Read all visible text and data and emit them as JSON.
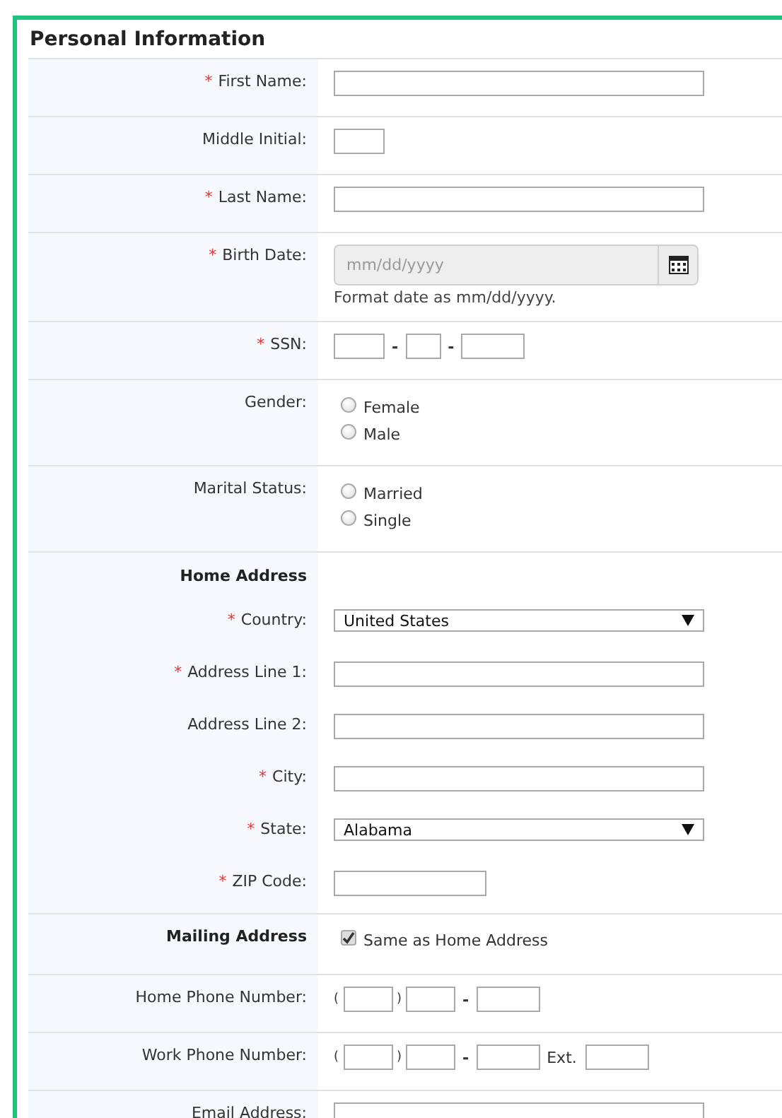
{
  "title": "Personal Information",
  "required_mark": "*",
  "rows": [
    {
      "kind": "text",
      "label": "First Name:",
      "required": true
    },
    {
      "kind": "initial",
      "label": "Middle Initial:",
      "required": false
    },
    {
      "kind": "text",
      "label": "Last Name:",
      "required": true
    },
    {
      "kind": "date",
      "label": "Birth Date:",
      "required": true,
      "placeholder": "mm/dd/yyyy",
      "hint": "Format date as mm/dd/yyyy."
    },
    {
      "kind": "ssn",
      "label": "SSN:",
      "required": true,
      "separator": "-"
    },
    {
      "kind": "radio",
      "label": "Gender:",
      "required": false,
      "options": [
        {
          "label": "Female",
          "selected": false
        },
        {
          "label": "Male",
          "selected": false
        }
      ]
    },
    {
      "kind": "radio",
      "label": "Marital Status:",
      "required": false,
      "options": [
        {
          "label": "Married",
          "selected": false
        },
        {
          "label": "Single",
          "selected": false
        }
      ]
    },
    {
      "kind": "group",
      "title": "Home Address",
      "fields": [
        {
          "kind": "select",
          "label": "Country:",
          "required": true,
          "value": "United States"
        },
        {
          "kind": "text",
          "label": "Address Line 1:",
          "required": true
        },
        {
          "kind": "text",
          "label": "Address Line 2:",
          "required": false
        },
        {
          "kind": "text",
          "label": "City:",
          "required": true
        },
        {
          "kind": "select",
          "label": "State:",
          "required": true,
          "value": "Alabama"
        },
        {
          "kind": "zip",
          "label": "ZIP Code:",
          "required": true
        }
      ]
    },
    {
      "kind": "checkbox",
      "label": "Mailing Address",
      "required": false,
      "option": "Same as Home Address",
      "checked": true
    },
    {
      "kind": "phone",
      "label": "Home Phone Number:",
      "required": false,
      "open": "(",
      "close": ")",
      "dash": "-"
    },
    {
      "kind": "phone",
      "label": "Work Phone Number:",
      "required": false,
      "open": "(",
      "close": ")",
      "dash": "-",
      "ext": "Ext."
    },
    {
      "kind": "text",
      "label": "Email Address:",
      "required": false
    }
  ]
}
